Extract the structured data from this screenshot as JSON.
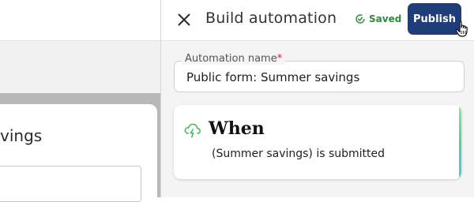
{
  "background_app": {
    "title_fragment": "vings"
  },
  "panel": {
    "title": "Build automation",
    "saved_label": "Saved",
    "publish_label": "Publish"
  },
  "automation_name": {
    "label": "Automation name",
    "required_marker": "*",
    "value": "Public form: Summer savings"
  },
  "trigger": {
    "heading": "When",
    "description": "(Summer savings) is submitted"
  },
  "colors": {
    "publish_bg": "#1f3d78",
    "saved_green": "#2f8a3b",
    "trigger_icon": "#4ab866",
    "required_red": "#d21f3c"
  }
}
